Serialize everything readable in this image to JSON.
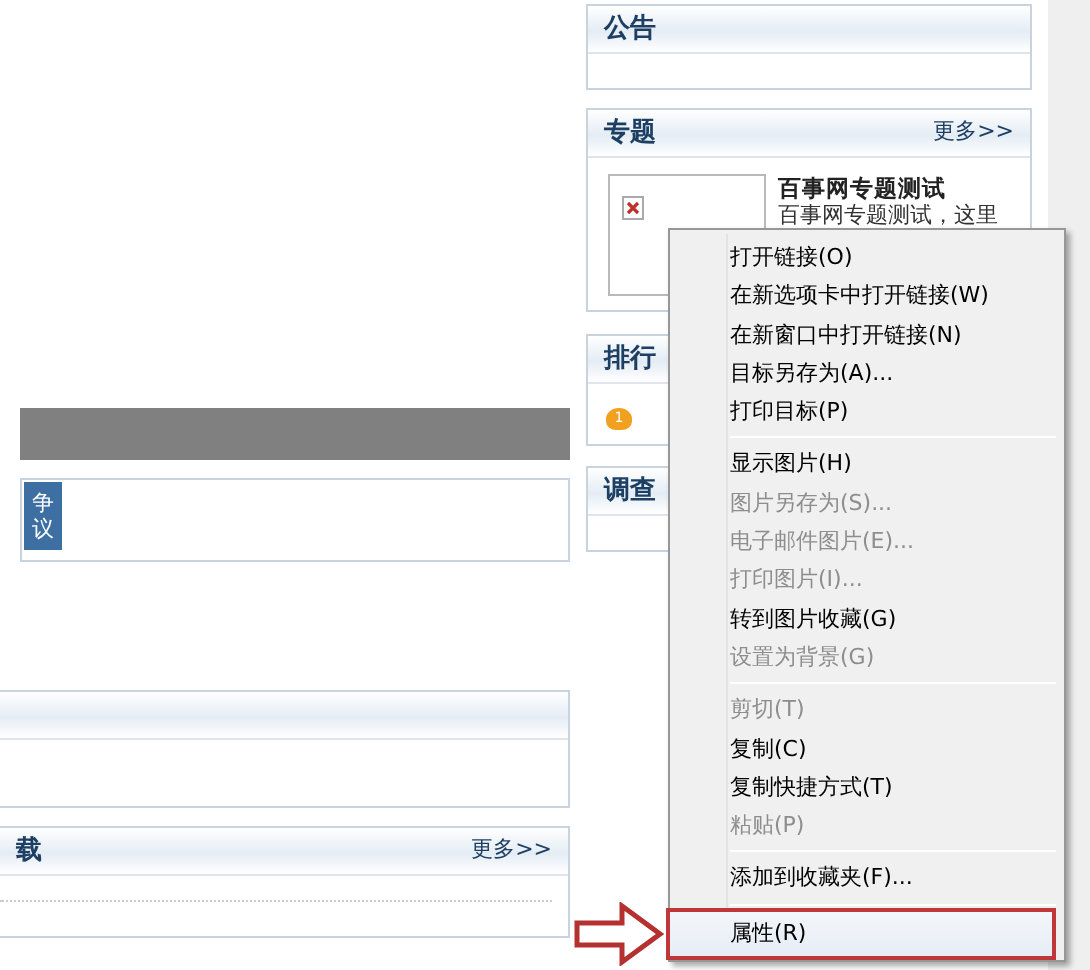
{
  "left": {
    "tag": "争议",
    "panels": [
      {
        "kind": "blank"
      },
      {
        "kind": "list",
        "title": "载",
        "more": "更多>>"
      }
    ]
  },
  "right_panels": [
    {
      "kind": "empty",
      "title": "公告"
    },
    {
      "kind": "feature",
      "title": "专题",
      "more": "更多>>",
      "item_title": "百事网专题测试",
      "item_text": "百事网专题测试，这里"
    },
    {
      "kind": "ranking",
      "title": "排行",
      "rank": "1"
    },
    {
      "kind": "empty",
      "title": "调查"
    }
  ],
  "context_menu": [
    {
      "kind": "item",
      "label": "打开链接(O)",
      "disabled": false,
      "highlighted": false
    },
    {
      "kind": "item",
      "label": "在新选项卡中打开链接(W)",
      "disabled": false,
      "highlighted": false
    },
    {
      "kind": "item",
      "label": "在新窗口中打开链接(N)",
      "disabled": false,
      "highlighted": false
    },
    {
      "kind": "item",
      "label": "目标另存为(A)...",
      "disabled": false,
      "highlighted": false
    },
    {
      "kind": "item",
      "label": "打印目标(P)",
      "disabled": false,
      "highlighted": false
    },
    {
      "kind": "separator"
    },
    {
      "kind": "item",
      "label": "显示图片(H)",
      "disabled": false,
      "highlighted": false
    },
    {
      "kind": "item",
      "label": "图片另存为(S)...",
      "disabled": true,
      "highlighted": false
    },
    {
      "kind": "item",
      "label": "电子邮件图片(E)...",
      "disabled": true,
      "highlighted": false
    },
    {
      "kind": "item",
      "label": "打印图片(I)...",
      "disabled": true,
      "highlighted": false
    },
    {
      "kind": "item",
      "label": "转到图片收藏(G)",
      "disabled": false,
      "highlighted": false
    },
    {
      "kind": "item",
      "label": "设置为背景(G)",
      "disabled": true,
      "highlighted": false
    },
    {
      "kind": "separator"
    },
    {
      "kind": "item",
      "label": "剪切(T)",
      "disabled": true,
      "highlighted": false
    },
    {
      "kind": "item",
      "label": "复制(C)",
      "disabled": false,
      "highlighted": false
    },
    {
      "kind": "item",
      "label": "复制快捷方式(T)",
      "disabled": false,
      "highlighted": false
    },
    {
      "kind": "item",
      "label": "粘贴(P)",
      "disabled": true,
      "highlighted": false
    },
    {
      "kind": "separator"
    },
    {
      "kind": "item",
      "label": "添加到收藏夹(F)...",
      "disabled": false,
      "highlighted": false
    },
    {
      "kind": "separator"
    },
    {
      "kind": "item",
      "label": "属性(R)",
      "disabled": false,
      "highlighted": true
    }
  ]
}
